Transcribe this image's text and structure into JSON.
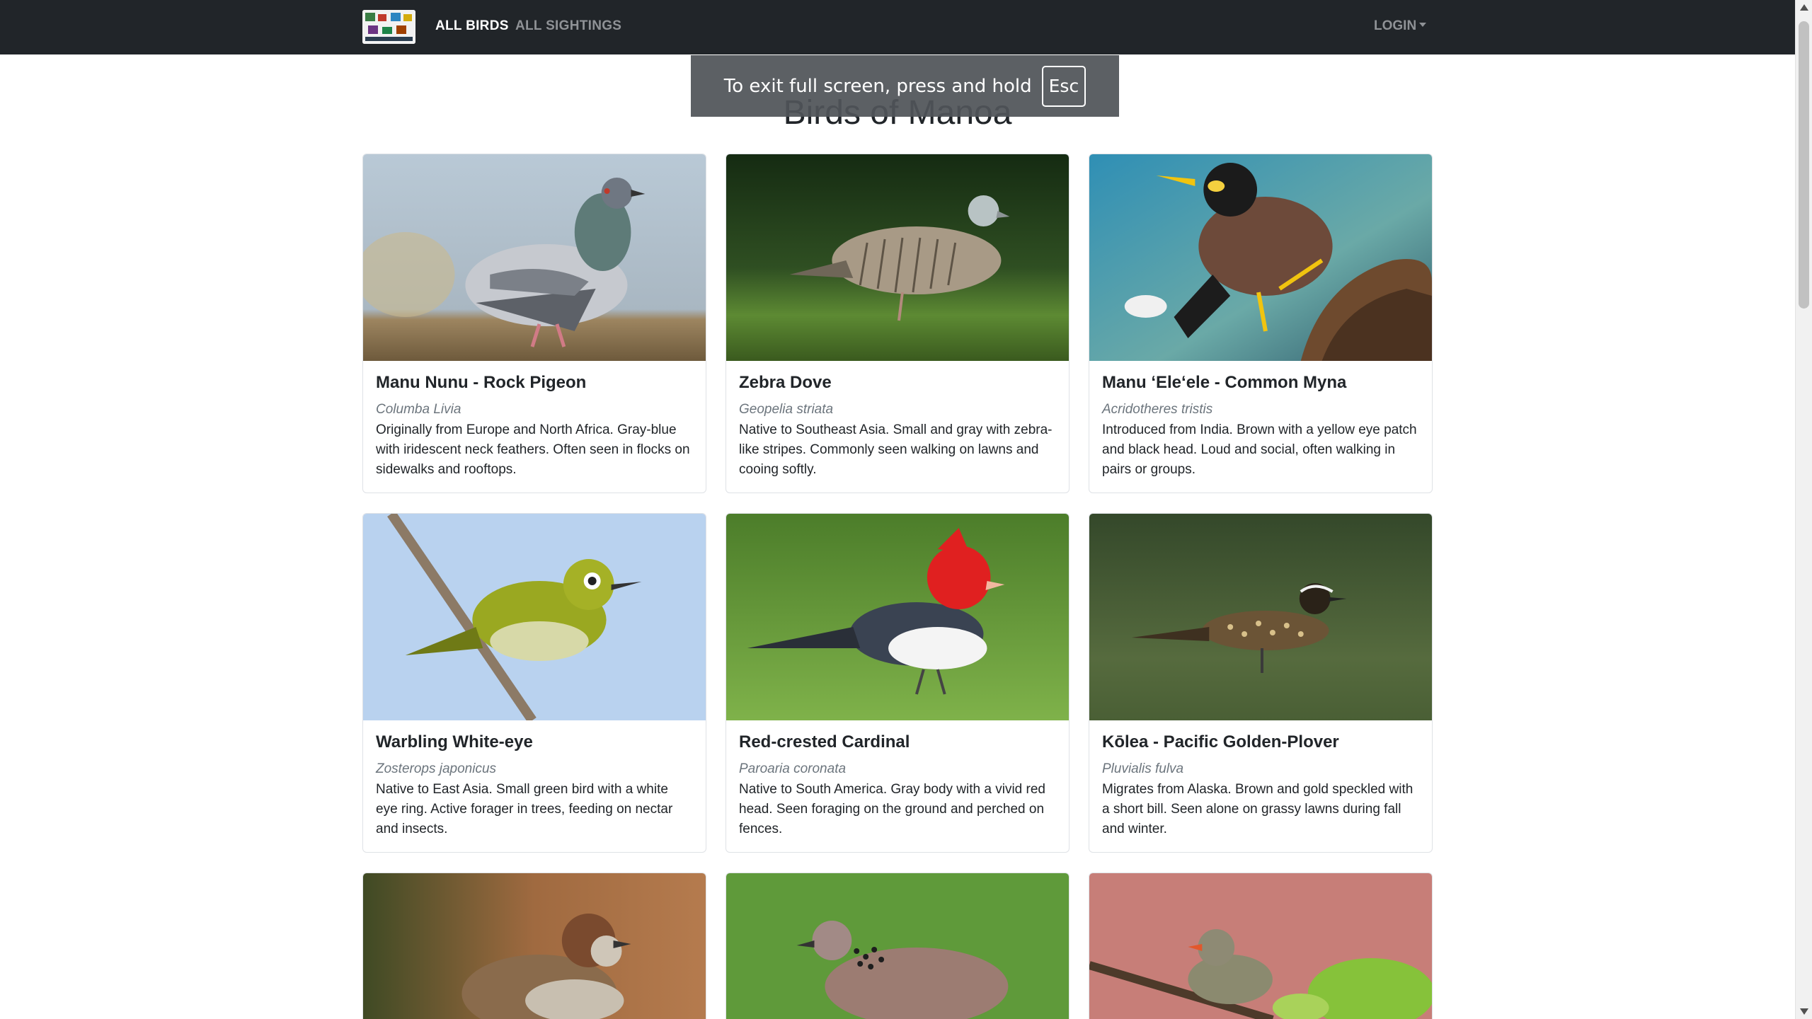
{
  "navbar": {
    "logo_icon": "site-logo-icon",
    "links": [
      {
        "label": "ALL BIRDS",
        "active": true
      },
      {
        "label": "ALL SIGHTINGS",
        "active": false
      }
    ],
    "login_label": "LOGIN"
  },
  "fullscreen_notice": {
    "text": "To exit full screen, press and hold",
    "key": "Esc"
  },
  "page": {
    "title": "Birds of Manoa"
  },
  "birds": [
    {
      "name": "Manu Nunu - Rock Pigeon",
      "scientific": "Columba Livia",
      "description": "Originally from Europe and North Africa. Gray-blue with iridescent neck feathers. Often seen in flocks on sidewalks and rooftops.",
      "image_icon": "rock-pigeon-photo"
    },
    {
      "name": "Zebra Dove",
      "scientific": "Geopelia striata",
      "description": "Native to Southeast Asia. Small and gray with zebra-like stripes. Commonly seen walking on lawns and cooing softly.",
      "image_icon": "zebra-dove-photo"
    },
    {
      "name": "Manu ʻEleʻele - Common Myna",
      "scientific": "Acridotheres tristis",
      "description": "Introduced from India. Brown with a yellow eye patch and black head. Loud and social, often walking in pairs or groups.",
      "image_icon": "common-myna-photo"
    },
    {
      "name": "Warbling White-eye",
      "scientific": "Zosterops japonicus",
      "description": "Native to East Asia. Small green bird with a white eye ring. Active forager in trees, feeding on nectar and insects.",
      "image_icon": "warbling-white-eye-photo"
    },
    {
      "name": "Red-crested Cardinal",
      "scientific": "Paroaria coronata",
      "description": "Native to South America. Gray body with a vivid red head. Seen foraging on the ground and perched on fences.",
      "image_icon": "red-crested-cardinal-photo"
    },
    {
      "name": "Kōlea - Pacific Golden-Plover",
      "scientific": "Pluvialis fulva",
      "description": "Migrates from Alaska. Brown and gold speckled with a short bill. Seen alone on grassy lawns during fall and winter.",
      "image_icon": "pacific-golden-plover-photo"
    },
    {
      "name": "",
      "scientific": "",
      "description": "",
      "image_icon": "house-sparrow-photo"
    },
    {
      "name": "",
      "scientific": "",
      "description": "",
      "image_icon": "spotted-dove-photo"
    },
    {
      "name": "",
      "scientific": "",
      "description": "",
      "image_icon": "waxbill-photo"
    }
  ],
  "colors": {
    "navbar_bg": "#212529",
    "nav_active": "#ffffff",
    "nav_muted": "#8f9296",
    "card_border": "#dfe2e6",
    "scientific_text": "#6c757d"
  }
}
